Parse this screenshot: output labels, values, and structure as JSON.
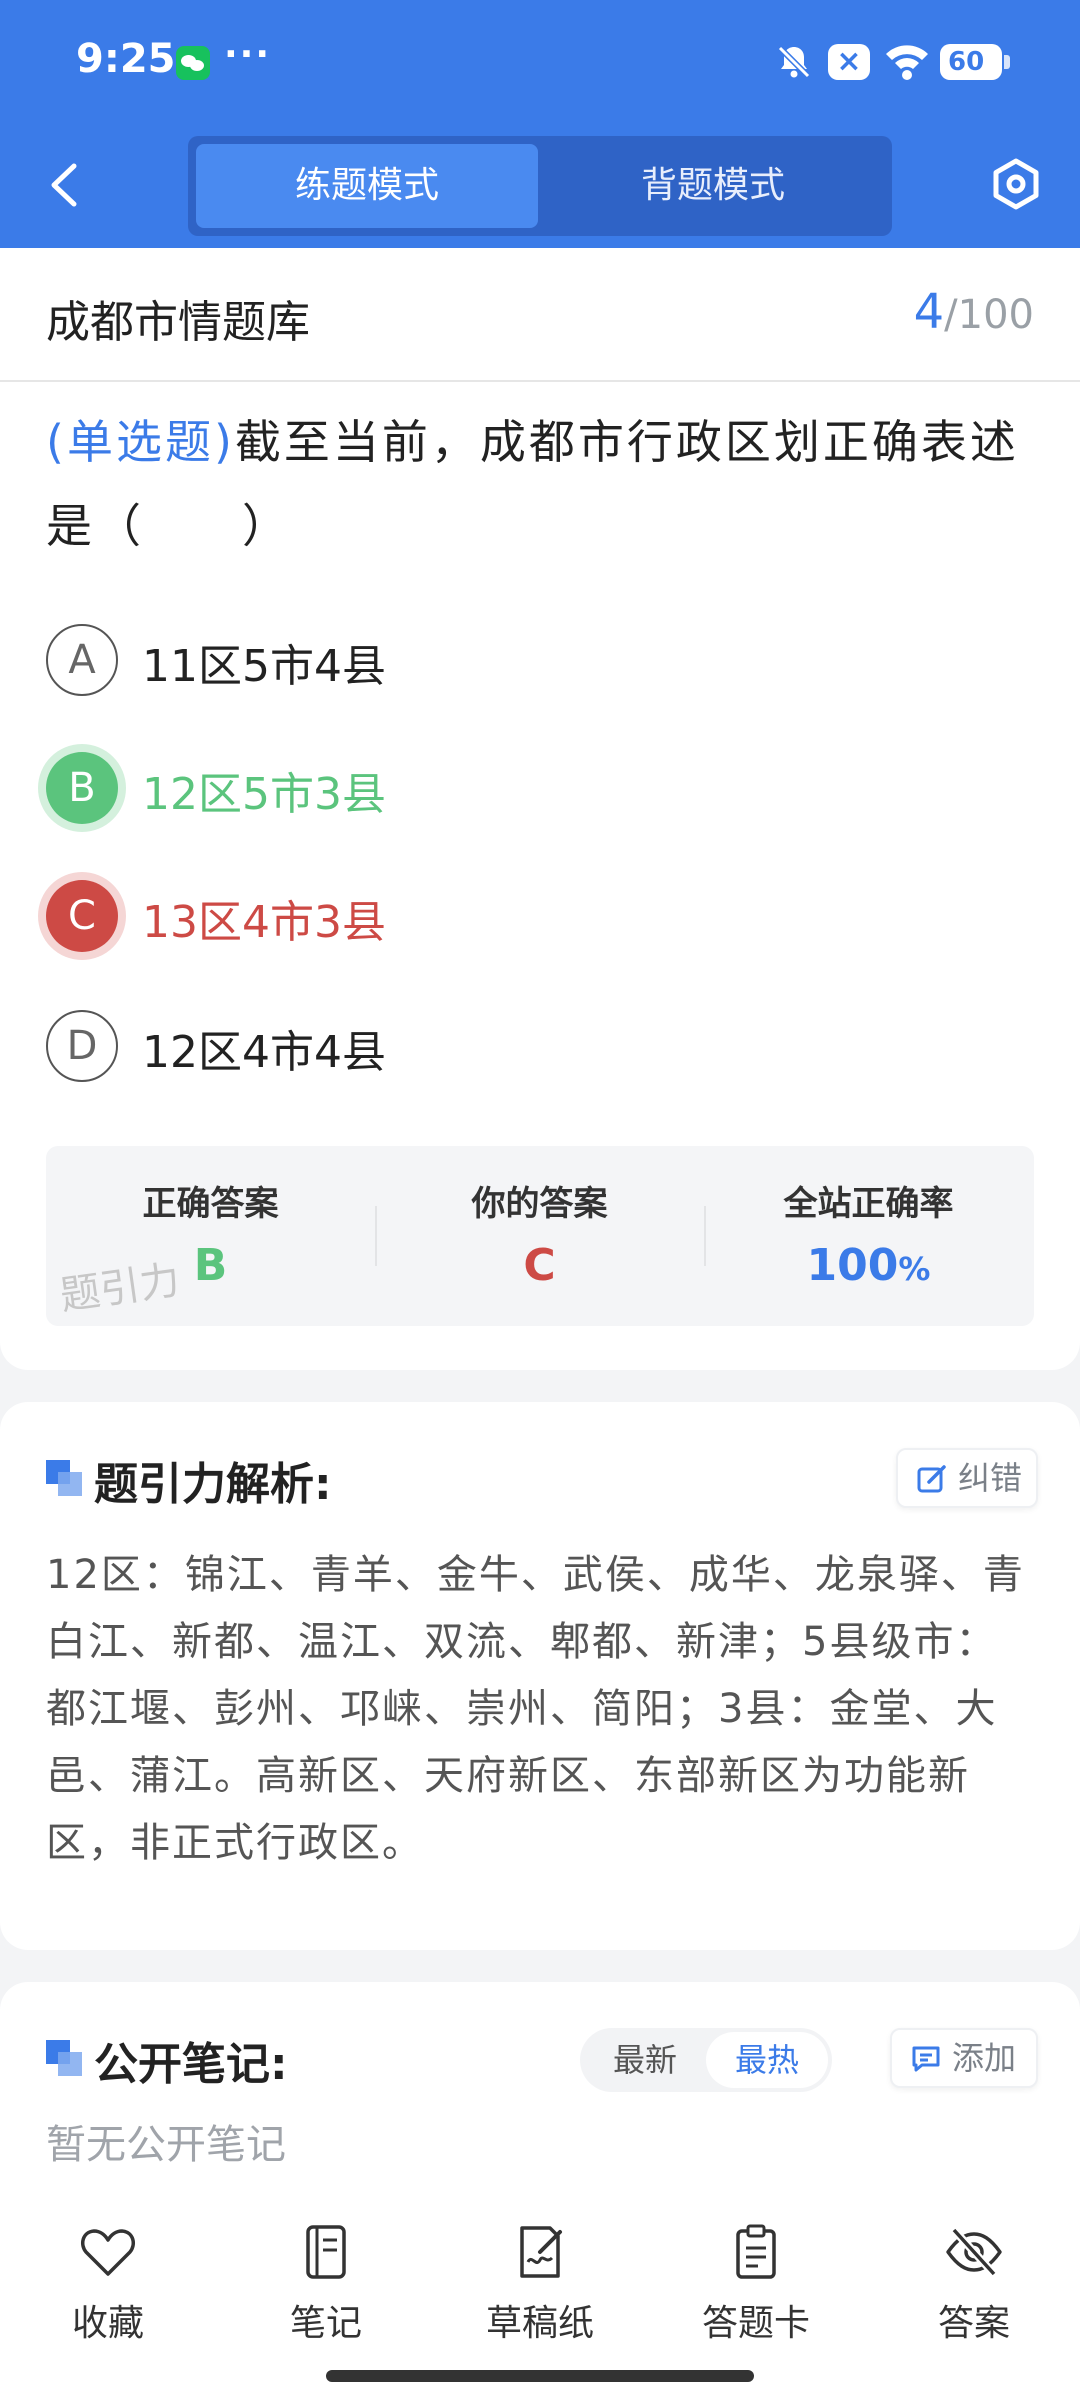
{
  "status_bar": {
    "time": "9:25",
    "dots": "···",
    "battery": "60"
  },
  "header": {
    "mode_tabs": [
      {
        "label": "练题模式",
        "active": true
      },
      {
        "label": "背题模式",
        "active": false
      }
    ]
  },
  "question_card": {
    "bank_title": "成都市情题库",
    "progress_current": "4",
    "progress_total": "/100",
    "question_type": "(单选题)",
    "question_text": "截至当前，成都市行政区划正确表述是（　　）",
    "options": [
      {
        "letter": "A",
        "text": "11区5市4县",
        "state": "normal"
      },
      {
        "letter": "B",
        "text": "12区5市3县",
        "state": "correct"
      },
      {
        "letter": "C",
        "text": "13区4市3县",
        "state": "wrong"
      },
      {
        "letter": "D",
        "text": "12区4市4县",
        "state": "normal"
      }
    ],
    "answer_summary": {
      "correct_label": "正确答案",
      "correct_value": "B",
      "yours_label": "你的答案",
      "yours_value": "C",
      "rate_label": "全站正确率",
      "rate_value": "100",
      "rate_unit": "%"
    },
    "watermark": "题引力"
  },
  "analysis": {
    "title": "题引力解析:",
    "report_label": "纠错",
    "text": "12区：锦江、青羊、金牛、武侯、成华、龙泉驿、青白江、新都、温江、双流、郫都、新津；5县级市：都江堰、彭州、邛崃、崇州、简阳；3县：金堂、大邑、蒲江。高新区、天府新区、东部新区为功能新区，非正式行政区。"
  },
  "notes": {
    "title": "公开笔记:",
    "sort_options": [
      "最新",
      "最热"
    ],
    "sort_selected": "最热",
    "add_label": "添加",
    "empty_text": "暂无公开笔记"
  },
  "bottom_nav": [
    {
      "label": "收藏",
      "icon": "heart-icon"
    },
    {
      "label": "笔记",
      "icon": "notebook-icon"
    },
    {
      "label": "草稿纸",
      "icon": "draft-icon"
    },
    {
      "label": "答题卡",
      "icon": "clipboard-icon"
    },
    {
      "label": "答案",
      "icon": "eye-off-icon"
    }
  ],
  "colors": {
    "primary": "#3b7be8",
    "correct": "#5bc47d",
    "wrong": "#cd4a45"
  }
}
